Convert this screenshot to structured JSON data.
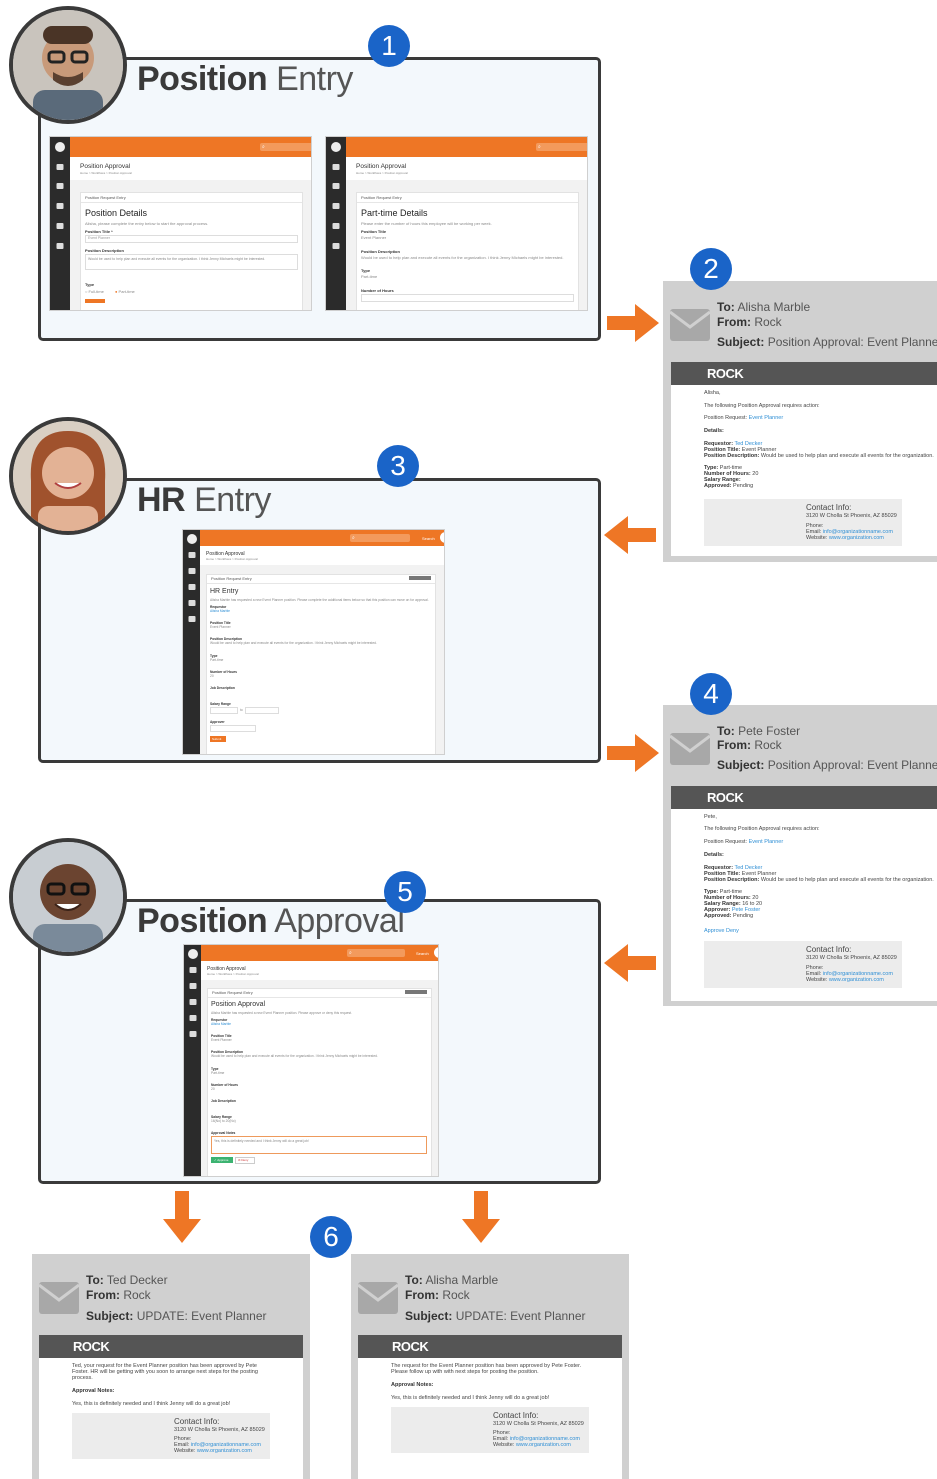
{
  "diagram": {
    "steps": [
      {
        "number": "1",
        "title_bold": "Position",
        "title_light": "Entry"
      },
      {
        "number": "2"
      },
      {
        "number": "3",
        "title_bold": "HR",
        "title_light": "Entry"
      },
      {
        "number": "4"
      },
      {
        "number": "5",
        "title_bold": "Position",
        "title_light": "Approval"
      },
      {
        "number": "6"
      }
    ]
  },
  "app": {
    "page_title": "Position Approval",
    "breadcrumb": "Home > Workflows > Position Approval",
    "card_header": "Position Request Entry",
    "search_label": "Search",
    "screen1": {
      "heading": "Position Details",
      "intro": "Alisha, please complete the entry below to start the approval process.",
      "f1_label": "Position Title *",
      "f1_value": "Event Planner",
      "f2_label": "Position Description",
      "f2_value": "Would be used to help plan and execute all events for the organization. I think Jenny Michaels might be interested.",
      "f3_label": "Type",
      "opt1": "Full-time",
      "opt2": "Part-time"
    },
    "screen2": {
      "heading": "Part-time Details",
      "intro": "Please enter the number of hours this employee will be working per week.",
      "f1_label": "Position Title",
      "f1_value": "Event Planner",
      "f2_label": "Position Description",
      "f2_value": "Would be used to help plan and execute all events for the organization. I think Jenny Michaels might be interested.",
      "f3_label": "Type",
      "f3_value": "Part-time",
      "f4_label": "Number of Hours"
    },
    "screen3": {
      "heading": "HR Entry",
      "intro": "Alisha Marble has requested a new Event Planner position. Please complete the additional items below so that this position can move on for approval.",
      "requestor_label": "Requestor",
      "requestor_value": "Alisha Marble",
      "f1_label": "Position Title",
      "f1_value": "Event Planner",
      "f2_label": "Position Description",
      "f2_value": "Would be used to help plan and execute all events for the organization. I think Jenny Michaels might be interested.",
      "f3_label": "Type",
      "f3_value": "Part-time",
      "f4_label": "Number of Hours",
      "f4_value": "20",
      "f5_label": "Job Description",
      "f6_label": "Salary Range",
      "f6_to": "to",
      "f7_label": "Approver",
      "submit": "Submit"
    },
    "screen5": {
      "heading": "Position Approval",
      "intro": "Alisha Marble has requested a new Event Planner position. Please approve or deny this request.",
      "requestor_label": "Requestor",
      "requestor_value": "Alisha Marble",
      "f1_label": "Position Title",
      "f1_value": "Event Planner",
      "f2_label": "Position Description",
      "f2_value": "Would be used to help plan and execute all events for the organization. I think Jenny Michaels might be interested.",
      "f3_label": "Type",
      "f3_value": "Part-time",
      "f4_label": "Number of Hours",
      "f4_value": "20",
      "f5_label": "Job Description",
      "f6_label": "Salary Range",
      "f6_value": "16(No) to 20(No)",
      "f7_label": "Approval Notes",
      "f7_value": "Yes, this is definitely needed and I think Jenny will do a great job!",
      "approve": "Approve",
      "deny": "Deny"
    }
  },
  "emails": {
    "brand": "ROCK",
    "labels": {
      "to": "To:",
      "from": "From:",
      "subject": "Subject:"
    },
    "contact": {
      "title": "Contact Info:",
      "address": "3120 W Cholla St Phoenix, AZ 85029",
      "phone_label": "Phone:",
      "email_label": "Email:",
      "email": "info@organizationname.com",
      "website_label": "Website:",
      "website": "www.organization.com"
    },
    "e2": {
      "to": "Alisha Marble",
      "from": "Rock",
      "subject": "Position Approval: Event Planner",
      "greeting": "Alisha,",
      "intro": "The following Position Approval requires action:",
      "request_label": "Position Request:",
      "request_link": "Event Planner",
      "details": "Details:",
      "requestor_label": "Requestor:",
      "requestor": "Ted Decker",
      "title_label": "Position Title:",
      "title": "Event Planner",
      "desc_label": "Position Description:",
      "desc": "Would be used to help plan and execute all events for the organization.",
      "type_label": "Type:",
      "type": "Part-time",
      "hours_label": "Number of Hours:",
      "hours": "20",
      "salary_label": "Salary Range:",
      "salary": "",
      "approved_label": "Approved:",
      "approved": "Pending"
    },
    "e4": {
      "to": "Pete Foster",
      "from": "Rock",
      "subject": "Position Approval: Event Planner",
      "greeting": "Pete,",
      "intro": "The following Position Approval requires action:",
      "request_label": "Position Request:",
      "request_link": "Event Planner",
      "details": "Details:",
      "requestor_label": "Requestor:",
      "requestor": "Ted Decker",
      "title_label": "Position Title:",
      "title": "Event Planner",
      "desc_label": "Position Description:",
      "desc": "Would be used to help plan and execute all events for the organization.",
      "type_label": "Type:",
      "type": "Part-time",
      "hours_label": "Number of Hours:",
      "hours": "20",
      "salary_label": "Salary Range:",
      "salary": "16 to 20",
      "approver_label": "Approver:",
      "approver": "Pete Foster",
      "approved_label": "Approved:",
      "approved": "Pending",
      "approve": "Approve",
      "deny": "Deny"
    },
    "e6a": {
      "to": "Ted Decker",
      "from": "Rock",
      "subject": "UPDATE: Event Planner",
      "body": "Ted, your request for the Event Planner position has been approved by Pete Foster. HR will be getting with you soon to arrange next steps for the posting process.",
      "notes_label": "Approval Notes:",
      "notes": "Yes, this is definitely needed and I think Jenny will do a great job!"
    },
    "e6b": {
      "to": "Alisha Marble",
      "from": "Rock",
      "subject": "UPDATE: Event Planner",
      "body": "The request for the Event Planner position has been approved by Pete Foster. Please follow up with with next steps for posting the position.",
      "notes_label": "Approval Notes:",
      "notes": "Yes, this is definitely needed and I think Jenny will do a great job!"
    }
  },
  "colors": {
    "accent": "#ee7625",
    "badge": "#1a64c8",
    "frame": "#3a3a3a",
    "email_bg": "#d0d0d0",
    "email_bar": "#555555"
  }
}
